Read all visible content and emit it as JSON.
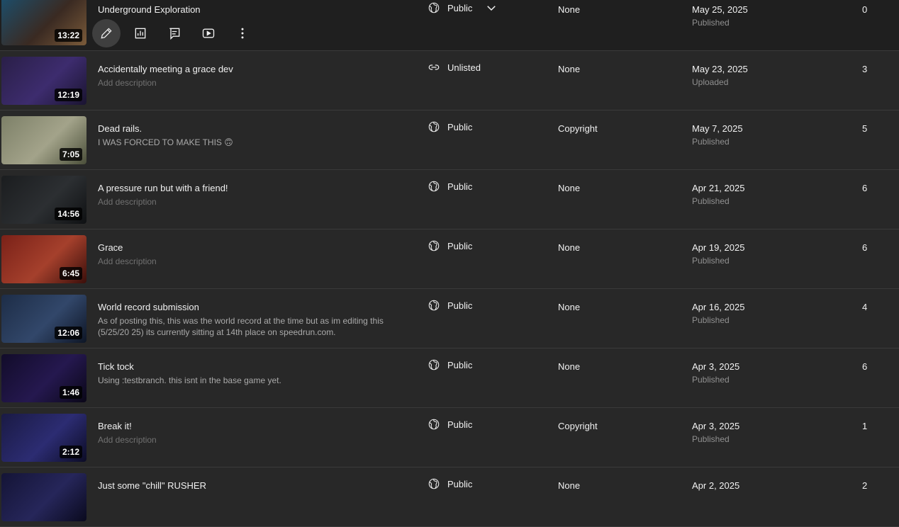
{
  "rows": [
    {
      "title": "Underground Exploration",
      "desc": "",
      "duration": "13:22",
      "visibility": "Public",
      "vis_icon": "globe",
      "restrictions": "None",
      "date": "May 25, 2025",
      "status": "Published",
      "views": "0",
      "thumb": [
        "#1c4e6b",
        "#3a2a22",
        "#7b5b3a"
      ]
    },
    {
      "title": "Accidentally meeting a grace dev",
      "desc": "Add description",
      "desc_placeholder": true,
      "duration": "12:19",
      "visibility": "Unlisted",
      "vis_icon": "link",
      "restrictions": "None",
      "date": "May 23, 2025",
      "status": "Uploaded",
      "views": "3",
      "thumb": [
        "#2a1f48",
        "#3d2c6e",
        "#1a1430"
      ]
    },
    {
      "title": "Dead rails.",
      "desc": "I WAS FORCED TO MAKE THIS 🙃",
      "duration": "7:05",
      "visibility": "Public",
      "vis_icon": "globe",
      "restrictions": "Copyright",
      "date": "May 7, 2025",
      "status": "Published",
      "views": "5",
      "thumb": [
        "#7d8068",
        "#a3a38a",
        "#4b4f3a"
      ]
    },
    {
      "title": "A pressure run but with a friend!",
      "desc": "Add description",
      "desc_placeholder": true,
      "duration": "14:56",
      "visibility": "Public",
      "vis_icon": "globe",
      "restrictions": "None",
      "date": "Apr 21, 2025",
      "status": "Published",
      "views": "6",
      "thumb": [
        "#1b1d1f",
        "#2c2f32",
        "#0f1113"
      ]
    },
    {
      "title": "Grace",
      "desc": "Add description",
      "desc_placeholder": true,
      "duration": "6:45",
      "visibility": "Public",
      "vis_icon": "globe",
      "restrictions": "None",
      "date": "Apr 19, 2025",
      "status": "Published",
      "views": "6",
      "thumb": [
        "#7a2118",
        "#a5402c",
        "#3b0f0b"
      ]
    },
    {
      "title": "World record submission",
      "desc": "As of posting this, this was the world record at the time but as im editing this (5/25/20 25) its currently sitting at 14th place on speedrun.com.",
      "duration": "12:06",
      "visibility": "Public",
      "vis_icon": "globe",
      "restrictions": "None",
      "date": "Apr 16, 2025",
      "status": "Published",
      "views": "4",
      "thumb": [
        "#1d2d47",
        "#32476a",
        "#0e1626"
      ]
    },
    {
      "title": "Tick tock",
      "desc": "Using :testbranch. this isnt in the base game yet.",
      "duration": "1:46",
      "visibility": "Public",
      "vis_icon": "globe",
      "restrictions": "None",
      "date": "Apr 3, 2025",
      "status": "Published",
      "views": "6",
      "thumb": [
        "#120c2a",
        "#25184f",
        "#0a0718"
      ]
    },
    {
      "title": "Break it!",
      "desc": "Add description",
      "desc_placeholder": true,
      "duration": "2:12",
      "visibility": "Public",
      "vis_icon": "globe",
      "restrictions": "Copyright",
      "date": "Apr 3, 2025",
      "status": "Published",
      "views": "1",
      "thumb": [
        "#1a1a44",
        "#2c2c72",
        "#0c0c26"
      ]
    },
    {
      "title": "Just some \"chill\" RUSHER",
      "desc": "",
      "duration": "",
      "visibility": "Public",
      "vis_icon": "globe",
      "restrictions": "None",
      "date": "Apr 2, 2025",
      "status": "",
      "views": "2",
      "thumb": [
        "#141436",
        "#26265a",
        "#0a0a1e"
      ]
    }
  ],
  "actions": [
    {
      "name": "edit-details-button",
      "icon": "pencil-icon",
      "active": true
    },
    {
      "name": "analytics-button",
      "icon": "analytics-icon",
      "active": false
    },
    {
      "name": "comments-button",
      "icon": "comments-icon",
      "active": false
    },
    {
      "name": "view-on-youtube-button",
      "icon": "youtube-icon",
      "active": false
    },
    {
      "name": "options-button",
      "icon": "more-vert-icon",
      "active": false
    }
  ]
}
